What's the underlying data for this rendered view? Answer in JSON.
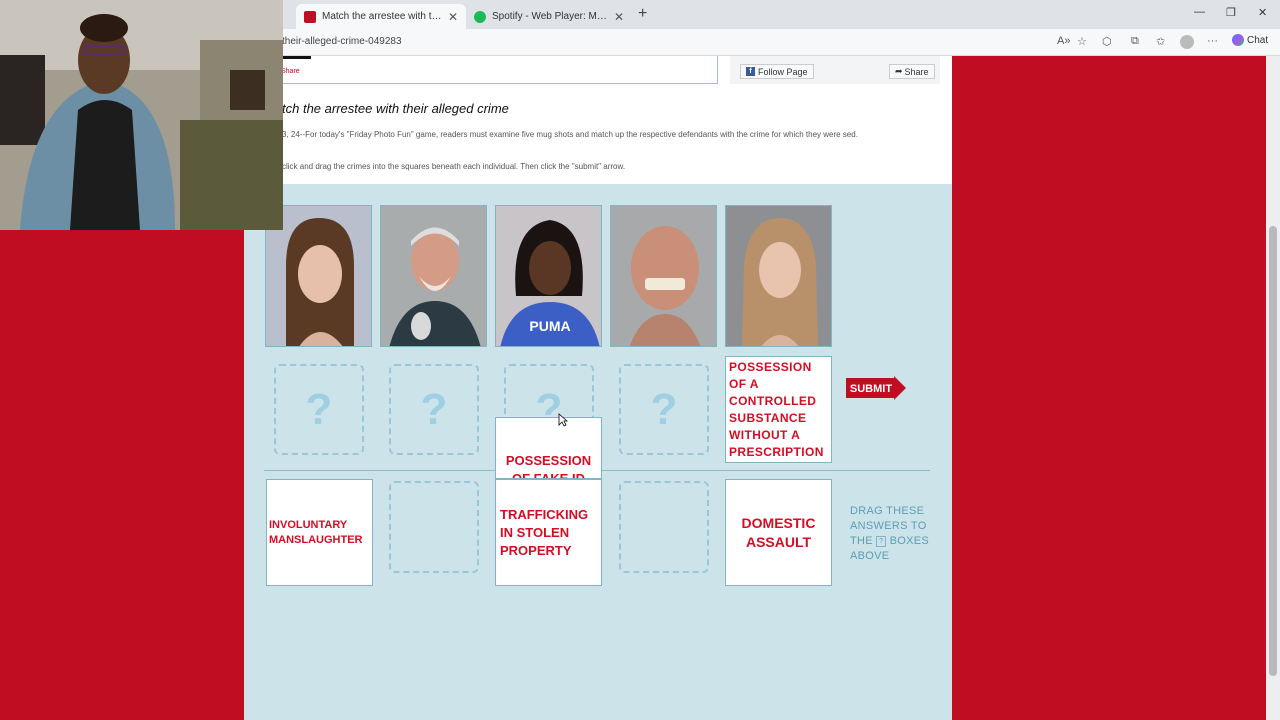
{
  "browser": {
    "tabs": [
      {
        "title": "Match the arrestee with their alleged crime",
        "active": true
      },
      {
        "title": "Spotify - Web Player: Music for everyone",
        "active": false
      }
    ],
    "url": "their-alleged-crime-049283",
    "chat_label": "Chat"
  },
  "article": {
    "share_link": "Share",
    "follow_label": "Follow Page",
    "share_label": "Share",
    "headline": "tch the arrestee with their alleged crime",
    "intro": "3, 24--For today's \"Friday Photo Fun\" game, readers must examine five mug shots and match up the respective defendants with the crime for which they were sed.",
    "instructions": "click and drag the crimes into the squares beneath each individual. Then click the \"submit\" arrow."
  },
  "game": {
    "question_mark": "?",
    "placed_answer": "POSSESSION OF A CONTROLLED SUBSTANCE WITHOUT A PRESCRIPTION",
    "dragging_answer": "POSSESSION OF FAKE ID",
    "answers": {
      "a1": "INVOLUNTARY MANSLAUGHTER",
      "a3": "TRAFFICKING IN STOLEN PROPERTY",
      "a5": "DOMESTIC ASSAULT"
    },
    "submit_label": "SUBMIT",
    "drag_hint": {
      "line1": "DRAG THESE",
      "line2": "ANSWERS TO",
      "line3a": "THE",
      "box": "?",
      "line3b": "BOXES",
      "line4": "ABOVE"
    }
  },
  "colors": {
    "brand_red": "#c10d22",
    "game_bg": "#cde3ea",
    "answer_text": "#d50d24"
  }
}
